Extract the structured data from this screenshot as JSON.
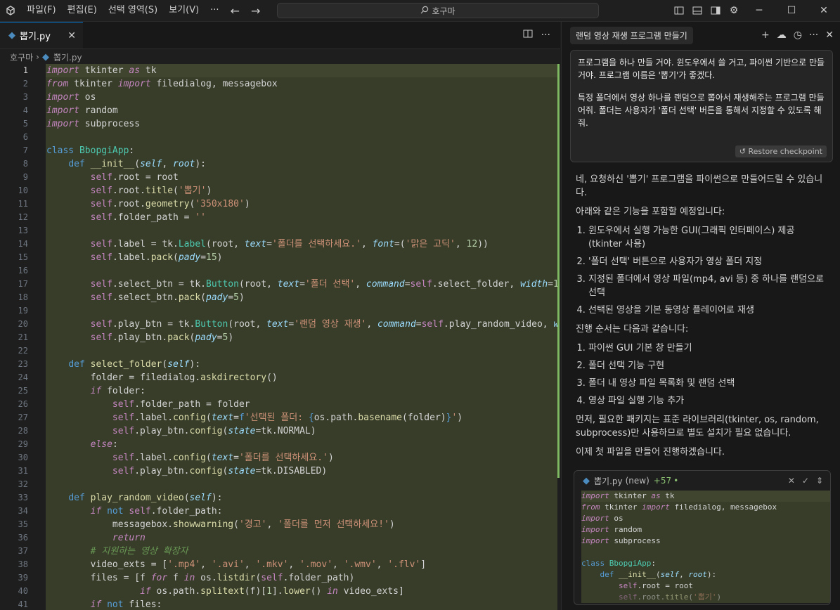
{
  "titlebar": {
    "menus": [
      "파일(F)",
      "편집(E)",
      "선택 영역(S)",
      "보기(V)",
      "···"
    ],
    "search_text": "호구마"
  },
  "editor": {
    "tab_label": "뽑기.py",
    "breadcrumb": [
      "호구마",
      "뽑기.py"
    ],
    "active_line": 1
  },
  "chat": {
    "title": "랜덤 영상 재생 프로그램 만들기",
    "user_message": [
      "프로그램을 하나 만들 거야. 윈도우에서 쓸 거고, 파이썬 기반으로 만들 거야. 프로그램 이름은 '뽑기'가 좋겠다.",
      "특정 폴더에서 영상 하나를 랜덤으로 뽑아서 재생해주는 프로그램 만들어줘. 폴더는 사용자가 '폴더 선택' 버튼을 통해서 지정할 수 있도록 해줘."
    ],
    "restore_label": "Restore checkpoint",
    "answer_intro": "네, 요청하신 '뽑기' 프로그램을 파이썬으로 만들어드릴 수 있습니다.",
    "features_intro": "아래와 같은 기능을 포함할 예정입니다:",
    "features": [
      "윈도우에서 실행 가능한 GUI(그래픽 인터페이스) 제공 (tkinter 사용)",
      "'폴더 선택' 버튼으로 사용자가 영상 폴더 지정",
      "지정된 폴더에서 영상 파일(mp4, avi 등) 중 하나를 랜덤으로 선택",
      "선택된 영상을 기본 동영상 플레이어로 재생"
    ],
    "steps_intro": "진행 순서는 다음과 같습니다:",
    "steps": [
      "파이썬 GUI 기본 창 만들기",
      "폴더 선택 기능 구현",
      "폴더 내 영상 파일 목록화 및 랜덤 선택",
      "영상 파일 실행 기능 추가"
    ],
    "packages_note": "먼저, 필요한 패키지는 표준 라이브러리(tkinter, os, random, subprocess)만 사용하므로 별도 설치가 필요 없습니다.",
    "closing": "이제 첫 파일을 만들어 진행하겠습니다.",
    "code_block": {
      "file": "뽑기.py",
      "status": "(new)",
      "added": "+57"
    }
  }
}
